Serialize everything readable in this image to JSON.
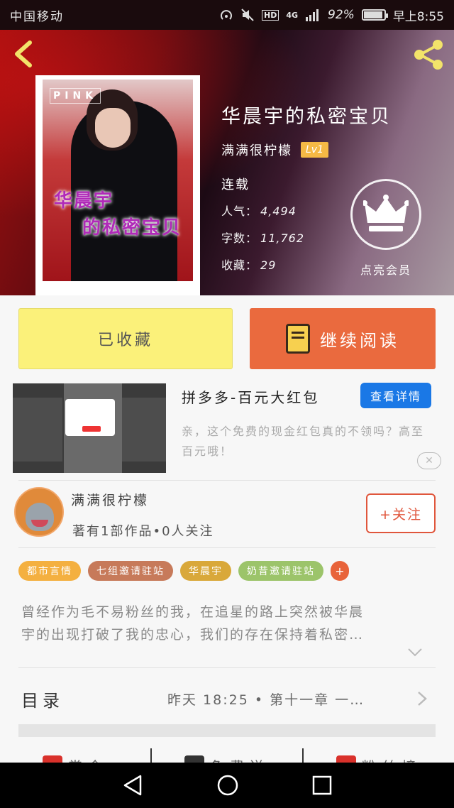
{
  "status_bar": {
    "carrier": "中国移动",
    "network": "4G",
    "battery_text": "92%",
    "battery_level": 0.92,
    "time": "早上8:55"
  },
  "book": {
    "title": "华晨宇的私密宝贝",
    "author": "满满很柠檬",
    "level": "Lv1",
    "status": "连载",
    "popularity_label": "人气：",
    "popularity": "4,494",
    "words_label": "字数：",
    "words": "11,762",
    "favorites_label": "收藏：",
    "favorites": "29",
    "vip_label": "点亮会员",
    "cover_text_top": "PINK",
    "cover_line1": "华晨宇",
    "cover_line2": "的私密宝贝"
  },
  "actions": {
    "collected": "已收藏",
    "continue_reading": "继续阅读"
  },
  "ad": {
    "title": "拼多多-百元大红包",
    "detail_button": "查看详情",
    "description": "亲，这个免费的现金红包真的不领吗？高至百元哦！",
    "close": "✕"
  },
  "author_card": {
    "name": "满满很柠檬",
    "stats": "著有1部作品•0人关注",
    "follow": "+关注"
  },
  "tags": [
    {
      "label": "都市言情",
      "color": "#f4b040"
    },
    {
      "label": "七组邀请驻站",
      "color": "#c77a5a"
    },
    {
      "label": "华晨宇",
      "color": "#d9a83a"
    },
    {
      "label": "奶昔邀请驻站",
      "color": "#9cc46a"
    }
  ],
  "tag_more": "+",
  "synopsis": {
    "line1": "曾经作为毛不易粉丝的我，在追星的路上突然被华晨",
    "line2": "宇的出现打破了我的忠心，我们的存在保持着私密…"
  },
  "toc": {
    "title": "目录",
    "latest": "昨天 18:25 • 第十一章  一…"
  },
  "bottom_tabs": [
    {
      "label": "赏金",
      "icon_color": "#d9312b"
    },
    {
      "label": "免费送",
      "icon_color": "#333333"
    },
    {
      "label": "粉丝榜",
      "icon_color": "#d9312b"
    }
  ]
}
